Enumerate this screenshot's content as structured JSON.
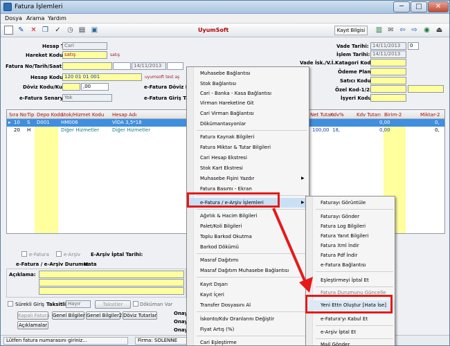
{
  "window": {
    "title": "Fatura İşlemleri",
    "min": "─",
    "max": "□",
    "close": "✕"
  },
  "menubar": [
    "Dosya",
    "Arama",
    "Yardım"
  ],
  "toolbar": {
    "icons": [
      "new-icon",
      "edit-icon",
      "delete-icon",
      "copy-icon",
      "approve-icon",
      "clock-icon",
      "print-icon",
      "preview-icon"
    ],
    "brand": "UyumSoft",
    "record_info": "Kayıt Bilgisi",
    "right_icons": [
      "save-icon",
      "mail-icon",
      "back-icon",
      "forward-icon",
      "web-icon",
      "exit-icon"
    ]
  },
  "form": {
    "hesap_tipi": {
      "label": "Hesap Tipi:",
      "value": "Cari"
    },
    "hareket_kodu": {
      "label": "Hareket Kodu:",
      "value": "satış",
      "note": "satış"
    },
    "fatura_no": {
      "label": "Fatura No/Tarih/Saat:",
      "date": "14/11/2013"
    },
    "hesap_kodu": {
      "label": "Hesap Kodu:",
      "value": "120 01 01 001",
      "note": "uyumsoft test aş"
    },
    "doviz": {
      "label": "Döviz Kodu/Kur:",
      "value": ",00"
    },
    "senaryo": {
      "label": "e-Fatura Senaryo:",
      "value": "Yok"
    },
    "doviz_kur_right": "e-Fatura Döviz K",
    "fatura_giris": "e-Fatura Giriş Ta",
    "vade_tarihi": {
      "label": "Vade Tarihi:",
      "value": "14/11/2013",
      "extra": "0"
    },
    "islem_tarihi": {
      "label": "İşlem Tarihi:",
      "value": "14/11/2013"
    },
    "vade_isk": {
      "label": "Vade İsk./V.İ.Katagori Kodu:"
    },
    "odeme_plani": {
      "label": "Ödeme Planı:"
    },
    "satici_kodu": {
      "label": "Satıcı Kodu:"
    },
    "ozel_kod": {
      "label": "Özel Kod-1/2:"
    },
    "isyeri_kodu": {
      "label": "İşyeri Kodu:"
    }
  },
  "grid": {
    "headers": [
      "Sıra No",
      "Tip",
      "Depo Kodu",
      "Stok/Hizmet Kodu",
      "Hesap Adı",
      "Net Tutarı",
      "Kdv%",
      "Kdv Tutarı",
      "Birim-2",
      "Miktar-2"
    ],
    "rows": [
      {
        "sira": "10",
        "tip": "S",
        "depo": "D001",
        "stok": "HM006",
        "hesap": "VİDA 3,5*18",
        "net": "",
        "kdv": "",
        "kdv_tutar": "0,00",
        "miktar2": "0,"
      },
      {
        "sira": "20",
        "tip": "H",
        "depo": "",
        "stok": "Diğer Hizmetler",
        "hesap": "Diğer Hizmetler",
        "net": "100,00",
        "kdv": "18,",
        "kdv_tutar": "0,00",
        "miktar2": "0,"
      }
    ]
  },
  "bottom": {
    "efatura": "e-Fatura",
    "earsiv": "e-Arşiv",
    "earsiv_iptal": "E-Arşiv İptal Tarihi:",
    "durum_label": "e-Fatura / e-Arşiv Durumu:",
    "durum_value": "Hata",
    "aciklama": "Açıklama:",
    "surekli": "Sürekli Giriş",
    "taksitli": "Taksitli:",
    "taksitli_value": "Hayır",
    "taksitler": "Taksitler",
    "dokuman": "Döküman Var",
    "buttons": [
      "Kapalı Fatura",
      "Genel Bilgiler",
      "Genel Bilgiler2",
      "Döviz Tutarlar",
      "Açıklamalar"
    ],
    "onay1": "Onay",
    "onay2": "Onay",
    "onay3": "Onay"
  },
  "status": {
    "message": "Lütfen fatura numarasını giriniz...",
    "firma": "Firma: SOLENNE"
  },
  "context_menu": [
    "Muhasebe Bağlantısı",
    "Stok Bağlantısı",
    "Cari - Banka - Kasa Bağlantısı",
    "Virman Hareketine Git",
    "Cari Virman Bağlantısı",
    "Dökümantasyonlar",
    "Fatura Kaynak Bilgileri",
    "Fatura Miktar & Tutar Bilgileri",
    "Cari Hesap Ekstresi",
    "Stok Kart Ekstresi",
    "Muhasebe Fişini Yazdır",
    "Fatura Basımı - Ekran",
    "e-Fatura / e-Arşiv İşlemleri",
    "Ağırlık & Hacim Bilgileri",
    "Palet/Koli Bilgileri",
    "Toplu Barkod Okutma",
    "Barkod Dökümü",
    "Masraf Dağıtımı",
    "Masraf Dağıtım Muhasebe Bağlantısı",
    "Kayıt Dışarı",
    "Kayıt İçeri",
    "Transfer Dosyasını Al",
    "İskonto/Kdv Oranlarını Değiştir",
    "Fiyat Artış (%)",
    "Cari Eşleştirme"
  ],
  "submenu": [
    "Faturayı Görüntüle",
    "Faturayı Gönder",
    "Fatura Log Bilgileri",
    "Fatura Yanıt Bilgileri",
    "Fatura Xml İndir",
    "Fatura Pdf İndir",
    "e-Fatura Bağlantısı",
    "Eşleştirmeyi İptal Et",
    "Fatura Durumunu Güncelle",
    "Yeni Ettn Oluştur [Hata İse]",
    "e-Fatura'yı Kabul Et",
    "e-Arşiv İptal Et",
    "Mail Gönder"
  ]
}
